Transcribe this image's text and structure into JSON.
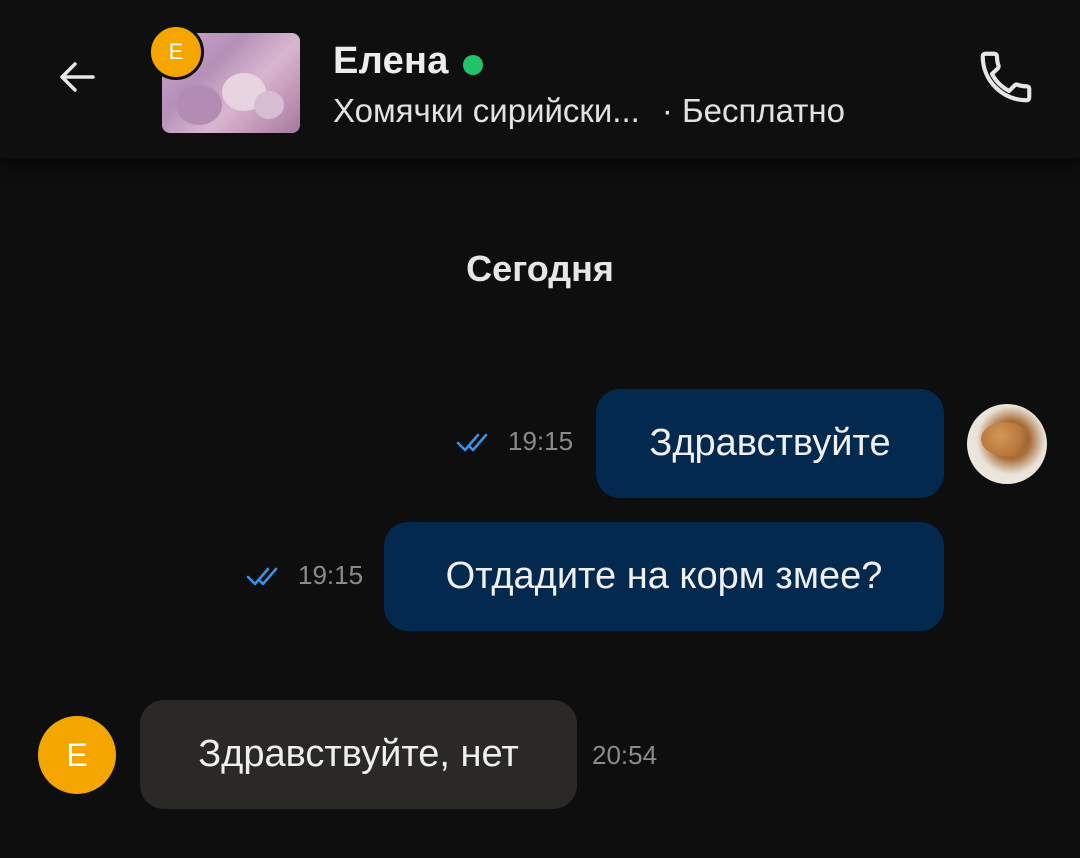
{
  "header": {
    "contact_name": "Елена",
    "contact_initial": "Е",
    "online_color": "#1fc46a",
    "listing_title": "Хомячки сирийски...",
    "listing_price": "· Бесплатно",
    "back_icon": "arrow-left-icon",
    "call_icon": "phone-icon"
  },
  "chat": {
    "date_separator": "Сегодня",
    "messages": [
      {
        "direction": "outgoing",
        "text": "Здравствуйте",
        "time": "19:15",
        "status": "read"
      },
      {
        "direction": "outgoing",
        "text": "Отдадите на корм змее?",
        "time": "19:15",
        "status": "read"
      },
      {
        "direction": "incoming",
        "text": "Здравствуйте, нет",
        "time": "20:54",
        "sender_initial": "Е"
      }
    ]
  },
  "colors": {
    "background": "#0e0e0e",
    "outgoing_bubble": "#03294f",
    "incoming_bubble": "#2a2925",
    "avatar_orange": "#f4a500",
    "read_check": "#3d8fe0"
  }
}
